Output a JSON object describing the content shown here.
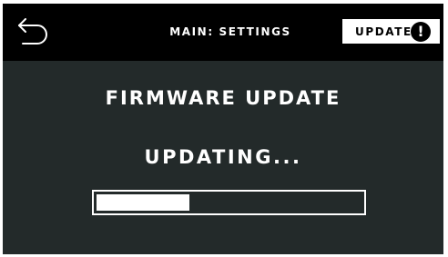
{
  "header": {
    "back_icon": "back-arrow-icon",
    "breadcrumb": "MAIN: SETTINGS",
    "update_button": {
      "label": "UPDATE",
      "icon": "exclamation-circle-icon",
      "icon_glyph": "!"
    }
  },
  "main": {
    "title": "FIRMWARE UPDATE",
    "status": "UPDATING...",
    "progress_fraction": 0.35
  },
  "colors": {
    "screen_background": "#232a2a",
    "topbar_background": "#000000",
    "text": "#ffffff",
    "button_background": "#ffffff",
    "progress_fill": "#ffffff"
  }
}
